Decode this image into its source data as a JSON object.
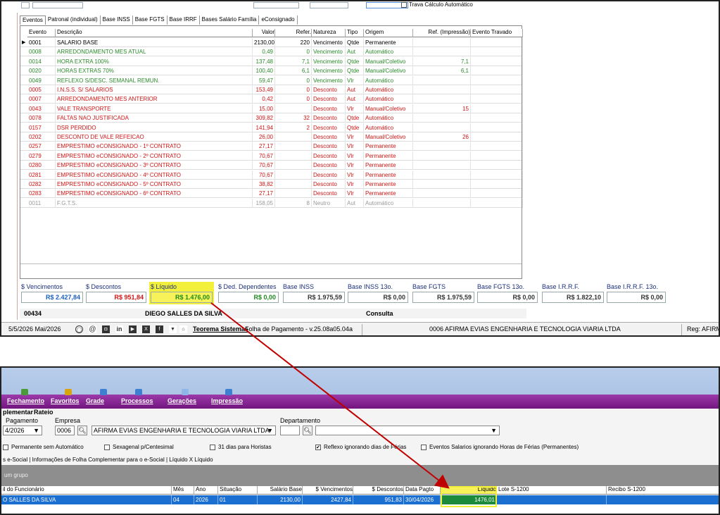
{
  "top_panel": {
    "header_checkbox_label": "Trava Cálculo Automático",
    "tabs": [
      "Eventos",
      "Patronal (individual)",
      "Base INSS",
      "Base FGTS",
      "Base IRRF",
      "Bases Salário Família",
      "eConsignado"
    ],
    "columns": [
      "Evento",
      "Descrição",
      "Valor",
      "Refer.",
      "Natureza",
      "Tipo",
      "Origem",
      "Ref. (Impressão)",
      "Evento Travado"
    ],
    "events": [
      {
        "code": "0001",
        "desc": "SALARIO BASE",
        "valor": "2130,00",
        "refer": "220",
        "natureza": "Vencimento",
        "tipo": "Qtde",
        "origem": "Permanente",
        "ref_imp": "",
        "color": "blk"
      },
      {
        "code": "0008",
        "desc": "ARREDONDAMENTO MES ATUAL",
        "valor": "0,49",
        "refer": "0",
        "natureza": "Vencimento",
        "tipo": "Aut",
        "origem": "Automático",
        "ref_imp": "",
        "color": "green"
      },
      {
        "code": "0014",
        "desc": "HORA EXTRA 100%",
        "valor": "137,48",
        "refer": "7,1",
        "natureza": "Vencimento",
        "tipo": "Qtde",
        "origem": "Manual/Coletivo",
        "ref_imp": "7,1",
        "color": "green"
      },
      {
        "code": "0020",
        "desc": "HORAS EXTRAS 70%",
        "valor": "100,40",
        "refer": "6,1",
        "natureza": "Vencimento",
        "tipo": "Qtde",
        "origem": "Manual/Coletivo",
        "ref_imp": "6,1",
        "color": "green"
      },
      {
        "code": "0049",
        "desc": "REFLEXO S/DESC. SEMANAL REMUN.",
        "valor": "59,47",
        "refer": "0",
        "natureza": "Vencimento",
        "tipo": "Vlr",
        "origem": "Automático",
        "ref_imp": "",
        "color": "green"
      },
      {
        "code": "0005",
        "desc": "I.N.S.S. S/ SALARIOS",
        "valor": "153,49",
        "refer": "0",
        "natureza": "Desconto",
        "tipo": "Aut",
        "origem": "Automático",
        "ref_imp": "",
        "color": "red"
      },
      {
        "code": "0007",
        "desc": "ARREDONDAMENTO MES ANTERIOR",
        "valor": "0,42",
        "refer": "0",
        "natureza": "Desconto",
        "tipo": "Aut",
        "origem": "Automático",
        "ref_imp": "",
        "color": "red"
      },
      {
        "code": "0043",
        "desc": "VALE TRANSPORTE",
        "valor": "15,00",
        "refer": "",
        "natureza": "Desconto",
        "tipo": "Vlr",
        "origem": "Manual/Coletivo",
        "ref_imp": "15",
        "color": "red"
      },
      {
        "code": "0078",
        "desc": "FALTAS NAO JUSTIFICADA",
        "valor": "309,82",
        "refer": "32",
        "natureza": "Desconto",
        "tipo": "Qtde",
        "origem": "Automático",
        "ref_imp": "",
        "color": "red"
      },
      {
        "code": "0157",
        "desc": "DSR PERDIDO",
        "valor": "141,94",
        "refer": "2",
        "natureza": "Desconto",
        "tipo": "Qtde",
        "origem": "Automático",
        "ref_imp": "",
        "color": "red"
      },
      {
        "code": "0202",
        "desc": "DESCONTO DE VALE REFEICAO",
        "valor": "26,00",
        "refer": "",
        "natureza": "Desconto",
        "tipo": "Vlr",
        "origem": "Manual/Coletivo",
        "ref_imp": "26",
        "color": "red"
      },
      {
        "code": "0257",
        "desc": "EMPRESTIMO eCONSIGNADO - 1º CONTRATO",
        "valor": "27,17",
        "refer": "",
        "natureza": "Desconto",
        "tipo": "Vlr",
        "origem": "Permanente",
        "ref_imp": "",
        "color": "red"
      },
      {
        "code": "0279",
        "desc": "EMPRESTIMO eCONSIGNADO - 2º CONTRATO",
        "valor": "70,67",
        "refer": "",
        "natureza": "Desconto",
        "tipo": "Vlr",
        "origem": "Permanente",
        "ref_imp": "",
        "color": "red"
      },
      {
        "code": "0280",
        "desc": "EMPRESTIMO eCONSIGNADO - 3º CONTRATO",
        "valor": "70,67",
        "refer": "",
        "natureza": "Desconto",
        "tipo": "Vlr",
        "origem": "Permanente",
        "ref_imp": "",
        "color": "red"
      },
      {
        "code": "0281",
        "desc": "EMPRESTIMO eCONSIGNADO - 4º CONTRATO",
        "valor": "70,67",
        "refer": "",
        "natureza": "Desconto",
        "tipo": "Vlr",
        "origem": "Permanente",
        "ref_imp": "",
        "color": "red"
      },
      {
        "code": "0282",
        "desc": "EMPRESTIMO eCONSIGNADO - 5º CONTRATO",
        "valor": "38,82",
        "refer": "",
        "natureza": "Desconto",
        "tipo": "Vlr",
        "origem": "Permanente",
        "ref_imp": "",
        "color": "red"
      },
      {
        "code": "0283",
        "desc": "EMPRESTIMO eCONSIGNADO - 6º CONTRATO",
        "valor": "27,17",
        "refer": "",
        "natureza": "Desconto",
        "tipo": "Vlr",
        "origem": "Permanente",
        "ref_imp": "",
        "color": "red"
      },
      {
        "code": "0011",
        "desc": "F.G.T.S.",
        "valor": "158,05",
        "refer": "8",
        "natureza": "Neutro",
        "tipo": "Aut",
        "origem": "Automático",
        "ref_imp": "",
        "color": "grey"
      }
    ],
    "summary": [
      {
        "label": "$ Vencimentos",
        "value": "R$ 2.427,84",
        "color": "#1a5fc0",
        "hl": false
      },
      {
        "label": "$ Descontos",
        "value": "R$ 951,84",
        "color": "#d01515",
        "hl": false
      },
      {
        "label": "$ Líquido",
        "value": "R$ 1.476,00",
        "color": "#1d8a1d",
        "hl": true
      },
      {
        "label": "$ Ded. Dependentes",
        "value": "R$ 0,00",
        "color": "#1d8a1d",
        "hl": false
      },
      {
        "label": "Base INSS",
        "value": "R$ 1.975,59",
        "color": "#333",
        "hl": false
      },
      {
        "label": "Base INSS 13o.",
        "value": "R$ 0,00",
        "color": "#333",
        "hl": false
      },
      {
        "label": "Base FGTS",
        "value": "R$ 1.975,59",
        "color": "#333",
        "hl": false
      },
      {
        "label": "Base FGTS 13o.",
        "value": "R$ 0,00",
        "color": "#333",
        "hl": false
      },
      {
        "label": "Base I.R.R.F.",
        "value": "R$ 1.822,10",
        "color": "#333",
        "hl": false
      },
      {
        "label": "Base I.R.R.F. 13o.",
        "value": "R$ 0,00",
        "color": "#333",
        "hl": false
      }
    ],
    "employee": {
      "code": "00434",
      "name": "DIEGO SALLES DA SILVA",
      "mode": "Consulta"
    },
    "statusbar": {
      "period": "5/5/2026 Mai/2026",
      "vendor": "Teorema Sistemas",
      "app": "Folha de Pagamento - v.25.08a05.04a",
      "company": "0006 AFIRMA EVIAS ENGENHARIA E TECNOLOGIA VIARIA LTDA",
      "reg": "Reg: AFIRM"
    }
  },
  "bottom_panel": {
    "menu": [
      "Fechamento",
      "Favoritos",
      "Grade",
      "Processos",
      "Gerações",
      "Impressão"
    ],
    "subtabs": [
      "plementar",
      "Rateio"
    ],
    "labels": {
      "pagamento": "Pagamento",
      "empresa": "Empresa",
      "departamento": "Departamento"
    },
    "pagamento_value": "4/2026",
    "empresa_code": "0006",
    "empresa_name": "AFIRMA EVIAS ENGENHARIA E TECNOLOGIA VIARIA LTDA",
    "options": [
      {
        "label": "Permanente sem Automático",
        "checked": false
      },
      {
        "label": "Sexagenal p/Centesimal",
        "checked": false
      },
      {
        "label": "31 dias para Horistas",
        "checked": false
      },
      {
        "label": "Reflexo ignorando dias de Férias",
        "checked": true
      },
      {
        "label": "Eventos Salarios ignorando Horas de Férias (Permanentes)",
        "checked": false
      }
    ],
    "links": "s e-Social | Informações de Folha Complementar para o e-Social | Líquido X Líquido",
    "group_hint": "um grupo",
    "columns": [
      "il do Funcionário",
      "Mês",
      "Ano",
      "Situação",
      "Salário Base",
      "$ Vencimentos",
      "$ Descontos",
      "Data Pagto",
      "Líquido",
      "Lote S-1200",
      "Recibo S-1200"
    ],
    "row": [
      "O SALLES DA SILVA",
      "04",
      "2026",
      "01",
      "2130,00",
      "2427,84",
      "951,83",
      "30/04/2026",
      "1476,01",
      "",
      ""
    ]
  },
  "colors": {
    "highlight": "#f2f03a",
    "arrow": "#c00000",
    "selected_row": "#1a6fd0",
    "ribbon_purple": "#8a2497"
  }
}
